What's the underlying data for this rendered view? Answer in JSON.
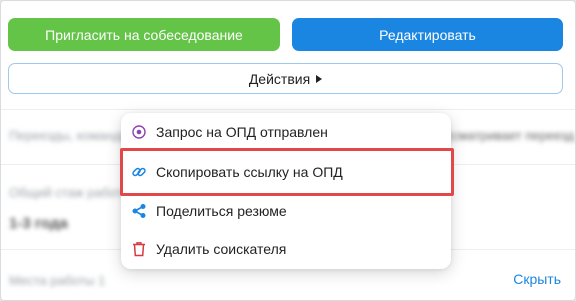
{
  "buttons": {
    "invite": "Пригласить на собеседование",
    "edit": "Редактировать",
    "actions": "Действия"
  },
  "menu": {
    "items": [
      {
        "label": "Запрос на ОПД отправлен",
        "icon": "radio-dot-icon"
      },
      {
        "label": "Скопировать ссылку на ОПД",
        "icon": "link-icon"
      },
      {
        "label": "Поделиться резюме",
        "icon": "share-icon"
      },
      {
        "label": "Удалить соискателя",
        "icon": "trash-icon"
      }
    ]
  },
  "background": {
    "field1_label": "Переезды, командировки",
    "field1_value": "Не рассматривает переезд",
    "field2_label": "Общий стаж работы",
    "field2_value": "1-3 года",
    "field3_label": "Места работы 1"
  },
  "hide_link": "Скрыть",
  "colors": {
    "invite_green": "#63c447",
    "edit_blue": "#1b86e2",
    "highlight_red": "#e0484a",
    "icon_purple": "#8e44ad",
    "icon_blue": "#1b86e2",
    "icon_red": "#d9363e"
  }
}
